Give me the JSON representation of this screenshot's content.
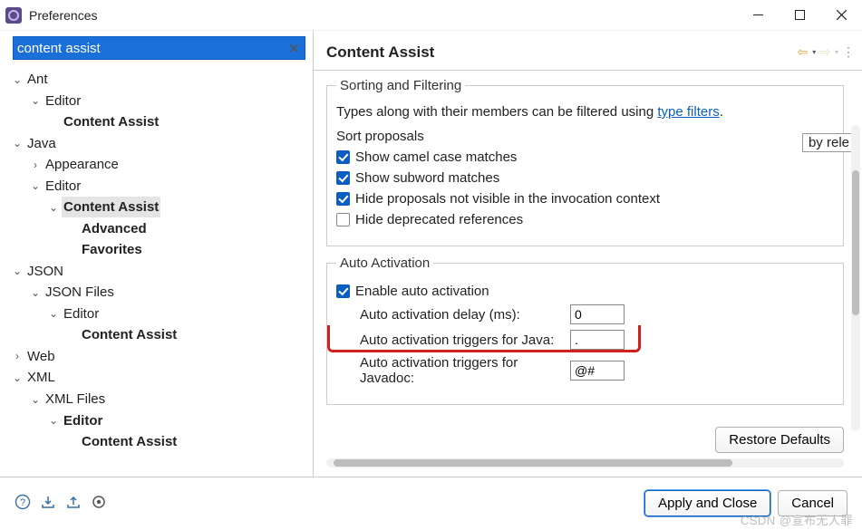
{
  "window": {
    "title": "Preferences"
  },
  "search": {
    "value": "content assist"
  },
  "page_title": "Content Assist",
  "tree": [
    {
      "d": 0,
      "e": "open",
      "l": "Ant",
      "b": false
    },
    {
      "d": 1,
      "e": "open",
      "l": "Editor",
      "b": false
    },
    {
      "d": 2,
      "e": "none",
      "l": "Content Assist",
      "b": true
    },
    {
      "d": 0,
      "e": "open",
      "l": "Java",
      "b": false
    },
    {
      "d": 1,
      "e": "closed",
      "l": "Appearance",
      "b": false
    },
    {
      "d": 1,
      "e": "open",
      "l": "Editor",
      "b": false
    },
    {
      "d": 2,
      "e": "open",
      "l": "Content Assist",
      "b": true,
      "sel": true
    },
    {
      "d": 3,
      "e": "none",
      "l": "Advanced",
      "b": true
    },
    {
      "d": 3,
      "e": "none",
      "l": "Favorites",
      "b": true
    },
    {
      "d": 0,
      "e": "open",
      "l": "JSON",
      "b": false
    },
    {
      "d": 1,
      "e": "open",
      "l": "JSON Files",
      "b": false
    },
    {
      "d": 2,
      "e": "open",
      "l": "Editor",
      "b": false
    },
    {
      "d": 3,
      "e": "none",
      "l": "Content Assist",
      "b": true
    },
    {
      "d": 0,
      "e": "closed",
      "l": "Web",
      "b": false
    },
    {
      "d": 0,
      "e": "open",
      "l": "XML",
      "b": false
    },
    {
      "d": 1,
      "e": "open",
      "l": "XML Files",
      "b": false
    },
    {
      "d": 2,
      "e": "open",
      "l": "Editor",
      "b": true
    },
    {
      "d": 3,
      "e": "none",
      "l": "Content Assist",
      "b": true
    }
  ],
  "sorting": {
    "legend": "Sorting and Filtering",
    "filter_sentence_pre": "Types along with their members can be filtered using ",
    "filter_link": "type filters",
    "filter_sentence_post": ".",
    "sort_label": "Sort proposals",
    "sort_value": "by rele",
    "cb_camel": "Show camel case matches",
    "cb_subword": "Show subword matches",
    "cb_hide_invoc": "Hide proposals not visible in the invocation context",
    "cb_hide_dep": "Hide deprecated references"
  },
  "auto": {
    "legend": "Auto Activation",
    "enable": "Enable auto activation",
    "delay_label": "Auto activation delay (ms):",
    "delay_value": "0",
    "java_label": "Auto activation triggers for Java:",
    "java_value": ".",
    "jdoc_label": "Auto activation triggers for Javadoc:",
    "jdoc_value": "@#"
  },
  "buttons": {
    "restore": "Restore Defaults",
    "apply_close": "Apply and Close",
    "cancel": "Cancel"
  },
  "watermark": "CSDN @宣布无人罪"
}
